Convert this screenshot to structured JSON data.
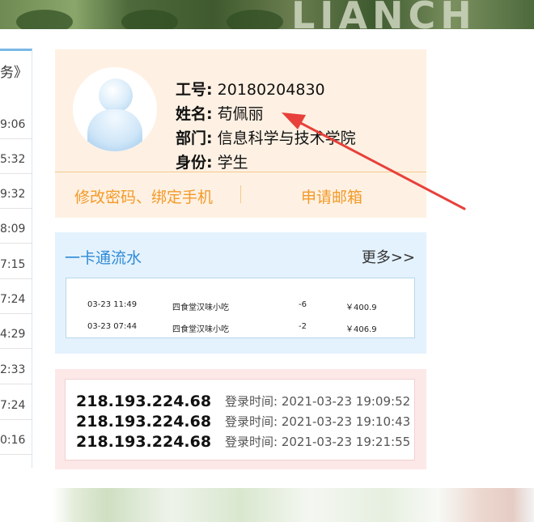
{
  "banner": {
    "letters": "LIANCH"
  },
  "left_panel": {
    "header": "务》",
    "times": [
      "9:06",
      "5:32",
      "9:32",
      "8:09",
      "7:15",
      "7:24",
      "4:29",
      "2:33",
      "7:24",
      "0:16"
    ]
  },
  "profile": {
    "rows": [
      {
        "label": "工号:",
        "value": "20180204830"
      },
      {
        "label": "姓名:",
        "value": "苟佩丽"
      },
      {
        "label": "部门:",
        "value": "信息科学与技术学院"
      },
      {
        "label": "身份:",
        "value": "学生"
      }
    ],
    "btn_password": "修改密码、绑定手机",
    "btn_mail": "申请邮箱"
  },
  "card": {
    "title": "一卡通流水",
    "more": "更多>>",
    "transactions": [
      {
        "time": "03-23 11:49",
        "place": "四食堂汉味小吃",
        "amount": "-6",
        "balance": "￥400.9"
      },
      {
        "time": "03-23 07:44",
        "place": "四食堂汉味小吃",
        "amount": "-2",
        "balance": "￥406.9"
      }
    ]
  },
  "logins": [
    {
      "ip": "218.193.224.68",
      "label": "登录时间:",
      "time": "2021-03-23 19:09:52"
    },
    {
      "ip": "218.193.224.68",
      "label": "登录时间:",
      "time": "2021-03-23 19:10:43"
    },
    {
      "ip": "218.193.224.68",
      "label": "登录时间:",
      "time": "2021-03-23 19:21:55"
    }
  ],
  "colors": {
    "accent_blue": "#2e8ad6",
    "accent_orange": "#f39a29",
    "arrow_red": "#e8403a"
  }
}
